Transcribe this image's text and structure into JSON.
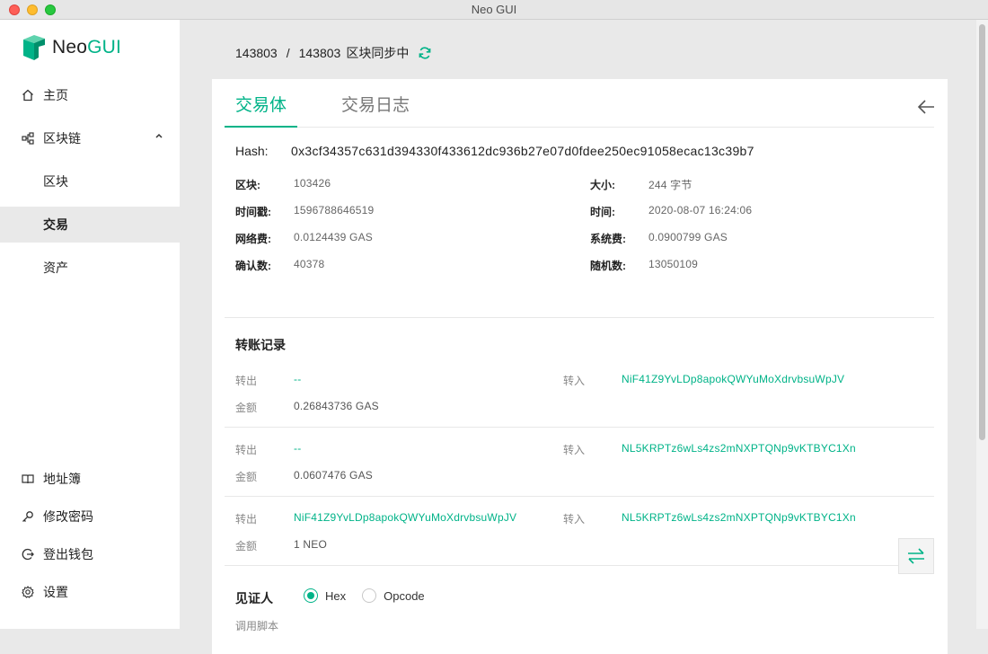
{
  "window": {
    "title": "Neo GUI"
  },
  "logo": {
    "neo": "Neo",
    "gui": "GUI"
  },
  "sidebar": {
    "home": "主页",
    "blockchain": "区块链",
    "blocks": "区块",
    "transactions": "交易",
    "assets": "资产",
    "address_book": "地址簿",
    "change_password": "修改密码",
    "logout": "登出钱包",
    "settings": "设置"
  },
  "sync": {
    "current": "143803",
    "separator": "/",
    "total": "143803",
    "status": "区块同步中"
  },
  "tabs": {
    "body": "交易体",
    "log": "交易日志"
  },
  "tx": {
    "hash_label": "Hash:",
    "hash": "0x3cf34357c631d394330f433612dc936b27e07d0fdee250ec91058ecac13c39b7",
    "block_label": "区块:",
    "block": "103426",
    "size_label": "大小:",
    "size": "244 字节",
    "timestamp_label": "时间戳:",
    "timestamp": "1596788646519",
    "time_label": "时间:",
    "time": "2020-08-07 16:24:06",
    "netfee_label": "网络费:",
    "netfee": "0.0124439 GAS",
    "sysfee_label": "系统费:",
    "sysfee": "0.0900799 GAS",
    "confirm_label": "确认数:",
    "confirm": "40378",
    "nonce_label": "随机数:",
    "nonce": "13050109"
  },
  "transfers": {
    "title": "转账记录",
    "out_label": "转出",
    "in_label": "转入",
    "amount_label": "金额",
    "items": [
      {
        "from": "--",
        "to": "NiF41Z9YvLDp8apokQWYuMoXdrvbsuWpJV",
        "amount": "0.26843736 GAS"
      },
      {
        "from": "--",
        "to": "NL5KRPTz6wLs4zs2mNXPTQNp9vKTBYC1Xn",
        "amount": "0.0607476 GAS"
      },
      {
        "from": "NiF41Z9YvLDp8apokQWYuMoXdrvbsuWpJV",
        "to": "NL5KRPTz6wLs4zs2mNXPTQNp9vKTBYC1Xn",
        "amount": "1 NEO"
      }
    ]
  },
  "witness": {
    "title": "见证人",
    "hex": "Hex",
    "opcode": "Opcode",
    "selected": "Hex",
    "script_label": "调用脚本"
  },
  "colors": {
    "accent": "#00b388",
    "active_nav_bg": "#e9e9e9"
  }
}
